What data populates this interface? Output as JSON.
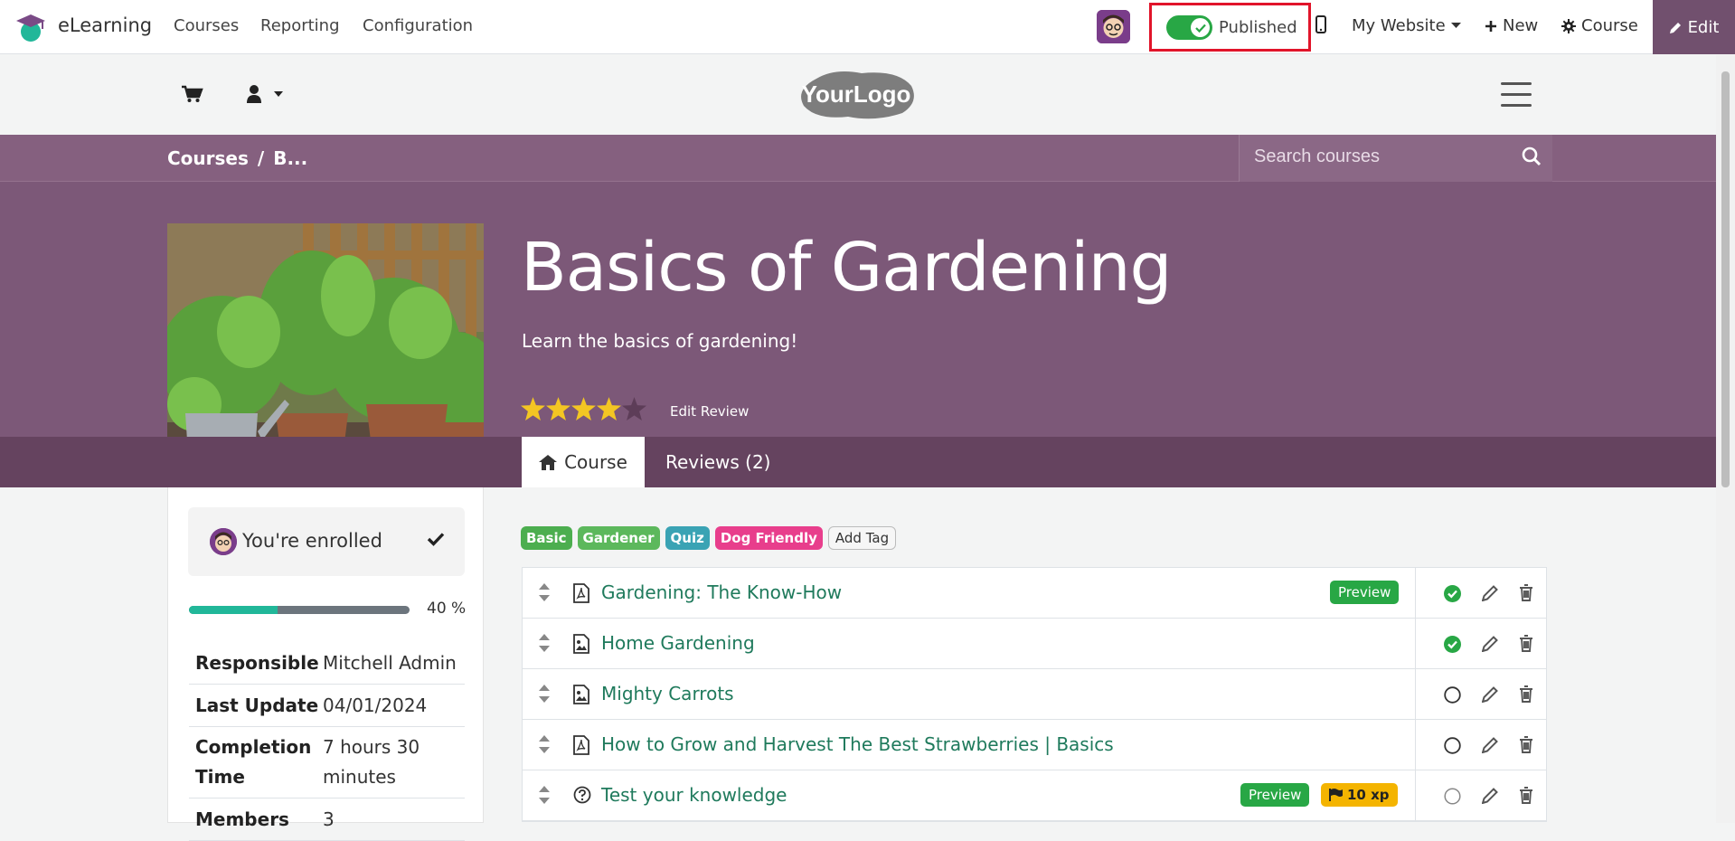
{
  "topbar": {
    "app_name": "eLearning",
    "menus": [
      "Courses",
      "Reporting",
      "Configuration"
    ],
    "published_label": "Published",
    "website_label": "My Website",
    "new_label": "New",
    "course_label": "Course",
    "edit_label": "Edit"
  },
  "header": {
    "logo_text": "YourLogo"
  },
  "hero": {
    "breadcrumb_root": "Courses",
    "breadcrumb_sep": "/",
    "breadcrumb_current": "B...",
    "search_placeholder": "Search courses",
    "title": "Basics of Gardening",
    "subtitle": "Learn the basics of gardening!",
    "rating": 4,
    "rating_max": 5,
    "edit_review": "Edit Review",
    "tabs": [
      {
        "label": "Course"
      },
      {
        "label": "Reviews (2)"
      }
    ]
  },
  "sidebar": {
    "enrolled_text": "You're enrolled",
    "progress_value": 0.4,
    "progress_text": "40 %",
    "info": [
      {
        "key": "Responsible",
        "value": "Mitchell Admin"
      },
      {
        "key": "Last Update",
        "value": "04/01/2024"
      },
      {
        "key": "Completion Time",
        "value": "7 hours 30 minutes"
      },
      {
        "key": "Members",
        "value": "3"
      }
    ]
  },
  "tags": [
    {
      "label": "Basic",
      "color": "#4cae4f"
    },
    {
      "label": "Gardener",
      "color": "#5cb85c"
    },
    {
      "label": "Quiz",
      "color": "#3aa3b4"
    },
    {
      "label": "Dog Friendly",
      "color": "#e83e8c"
    }
  ],
  "add_tag_label": "Add Tag",
  "lessons": [
    {
      "name": "Gardening: The Know-How",
      "type": "pdf",
      "preview": "Preview",
      "xp": "",
      "done": true
    },
    {
      "name": "Home Gardening",
      "type": "image",
      "preview": "",
      "xp": "",
      "done": true
    },
    {
      "name": "Mighty Carrots",
      "type": "image",
      "preview": "",
      "xp": "",
      "done": false
    },
    {
      "name": "How to Grow and Harvest The Best Strawberries | Basics",
      "type": "pdf",
      "preview": "",
      "xp": "",
      "done": false
    },
    {
      "name": "Test your knowledge",
      "type": "quiz",
      "preview": "Preview",
      "xp": "10 xp",
      "done": false
    }
  ],
  "colors": {
    "brand": "#71506e",
    "hero": "#7c5878",
    "success": "#28a745",
    "lesson_link": "#1f7a5c",
    "highlight_box": "#e1142a"
  }
}
